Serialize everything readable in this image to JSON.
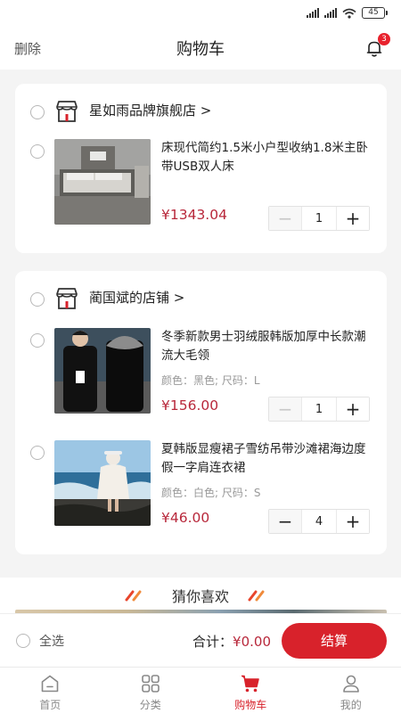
{
  "status_bar": {
    "battery": "45"
  },
  "header": {
    "left_label": "删除",
    "title": "购物车",
    "notification_count": "3"
  },
  "stores": [
    {
      "name": "星如雨品牌旗舰店",
      "items": [
        {
          "title": "床现代简约1.5米小户型收纳1.8米主卧带USB双人床",
          "spec": "",
          "price": "¥1343.04",
          "qty": "1"
        }
      ]
    },
    {
      "name": "蔺国斌的店铺",
      "items": [
        {
          "title": "冬季新款男士羽绒服韩版加厚中长款潮流大毛领",
          "spec": "颜色：黑色; 尺码：L",
          "price": "¥156.00",
          "qty": "1"
        },
        {
          "title": "夏韩版显瘦裙子雪纺吊带沙滩裙海边度假一字肩连衣裙",
          "spec": "颜色：白色; 尺码：S",
          "price": "¥46.00",
          "qty": "4"
        }
      ]
    }
  ],
  "guess": {
    "title": "猜你喜欢"
  },
  "checkout": {
    "select_all": "全选",
    "total_label": "合计：",
    "total_amount": "¥0.00",
    "button": "结算"
  },
  "tabs": [
    {
      "label": "首页",
      "icon": "home-icon"
    },
    {
      "label": "分类",
      "icon": "category-icon"
    },
    {
      "label": "购物车",
      "icon": "cart-icon",
      "active": true
    },
    {
      "label": "我的",
      "icon": "user-icon"
    }
  ],
  "colors": {
    "accent": "#d8222b",
    "price": "#b8283b",
    "background": "#f4f4f4"
  }
}
